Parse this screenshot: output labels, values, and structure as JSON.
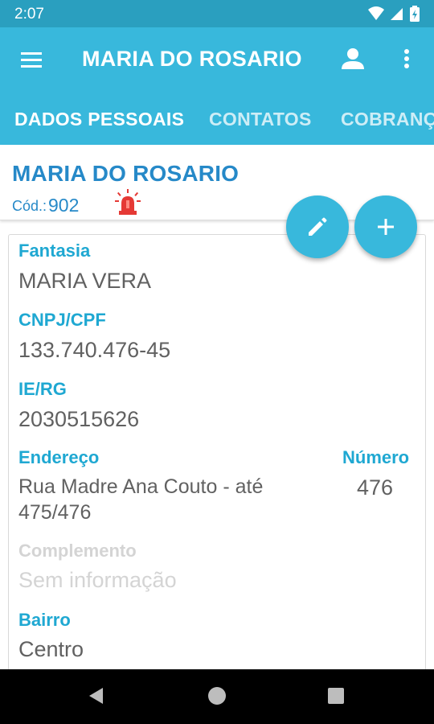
{
  "status_bar": {
    "time": "2:07",
    "icons": [
      "wifi-icon",
      "signal-icon",
      "battery-icon"
    ]
  },
  "app_bar": {
    "title": "MARIA DO ROSARIO",
    "menu_icon": "menu-icon",
    "person_icon": "person-icon",
    "more_icon": "more-vert-icon"
  },
  "tabs": [
    {
      "label": "DADOS PESSOAIS",
      "active": true
    },
    {
      "label": "CONTATOS",
      "active": false
    },
    {
      "label": "COBRANÇ",
      "active": false
    }
  ],
  "client": {
    "name": "MARIA DO ROSARIO",
    "code_label": "Cód.:",
    "code_value": "902",
    "alert_icon": "siren-icon"
  },
  "fabs": {
    "edit_icon": "pencil-icon",
    "add_icon": "plus-icon"
  },
  "fields": {
    "fantasia": {
      "label": "Fantasia",
      "value": "MARIA VERA"
    },
    "cnpj_cpf": {
      "label": "CNPJ/CPF",
      "value": "133.740.476-45"
    },
    "ie_rg": {
      "label": "IE/RG",
      "value": "2030515626"
    },
    "endereco": {
      "label": "Endereço",
      "value_line1": "Rua Madre Ana Couto - até",
      "value_line2": "475/476"
    },
    "numero": {
      "label": "Número",
      "value": "476"
    },
    "complemento": {
      "label": "Complemento",
      "value": "Sem informação"
    },
    "bairro": {
      "label": "Bairro",
      "value": "Centro"
    }
  },
  "colors": {
    "primary": "#38b8dc",
    "status_bar": "#2a9fbf",
    "label_blue": "#1fa8d2",
    "header_blue": "#2689c8",
    "alert_red": "#e53935"
  }
}
